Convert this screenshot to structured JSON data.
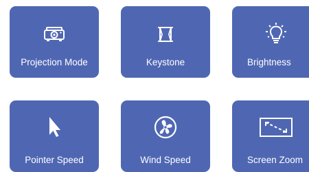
{
  "tiles": [
    {
      "label": "Projection Mode",
      "icon": "projector-icon"
    },
    {
      "label": "Keystone",
      "icon": "keystone-icon"
    },
    {
      "label": "Brightness",
      "icon": "brightness-icon"
    },
    {
      "label": "Pointer Speed",
      "icon": "pointer-icon"
    },
    {
      "label": "Wind Speed",
      "icon": "fan-icon"
    },
    {
      "label": "Screen Zoom",
      "icon": "screen-zoom-icon"
    }
  ],
  "colors": {
    "tile_background": "#4f67b3",
    "tile_foreground": "#ffffff",
    "page_background": "#ffffff"
  }
}
